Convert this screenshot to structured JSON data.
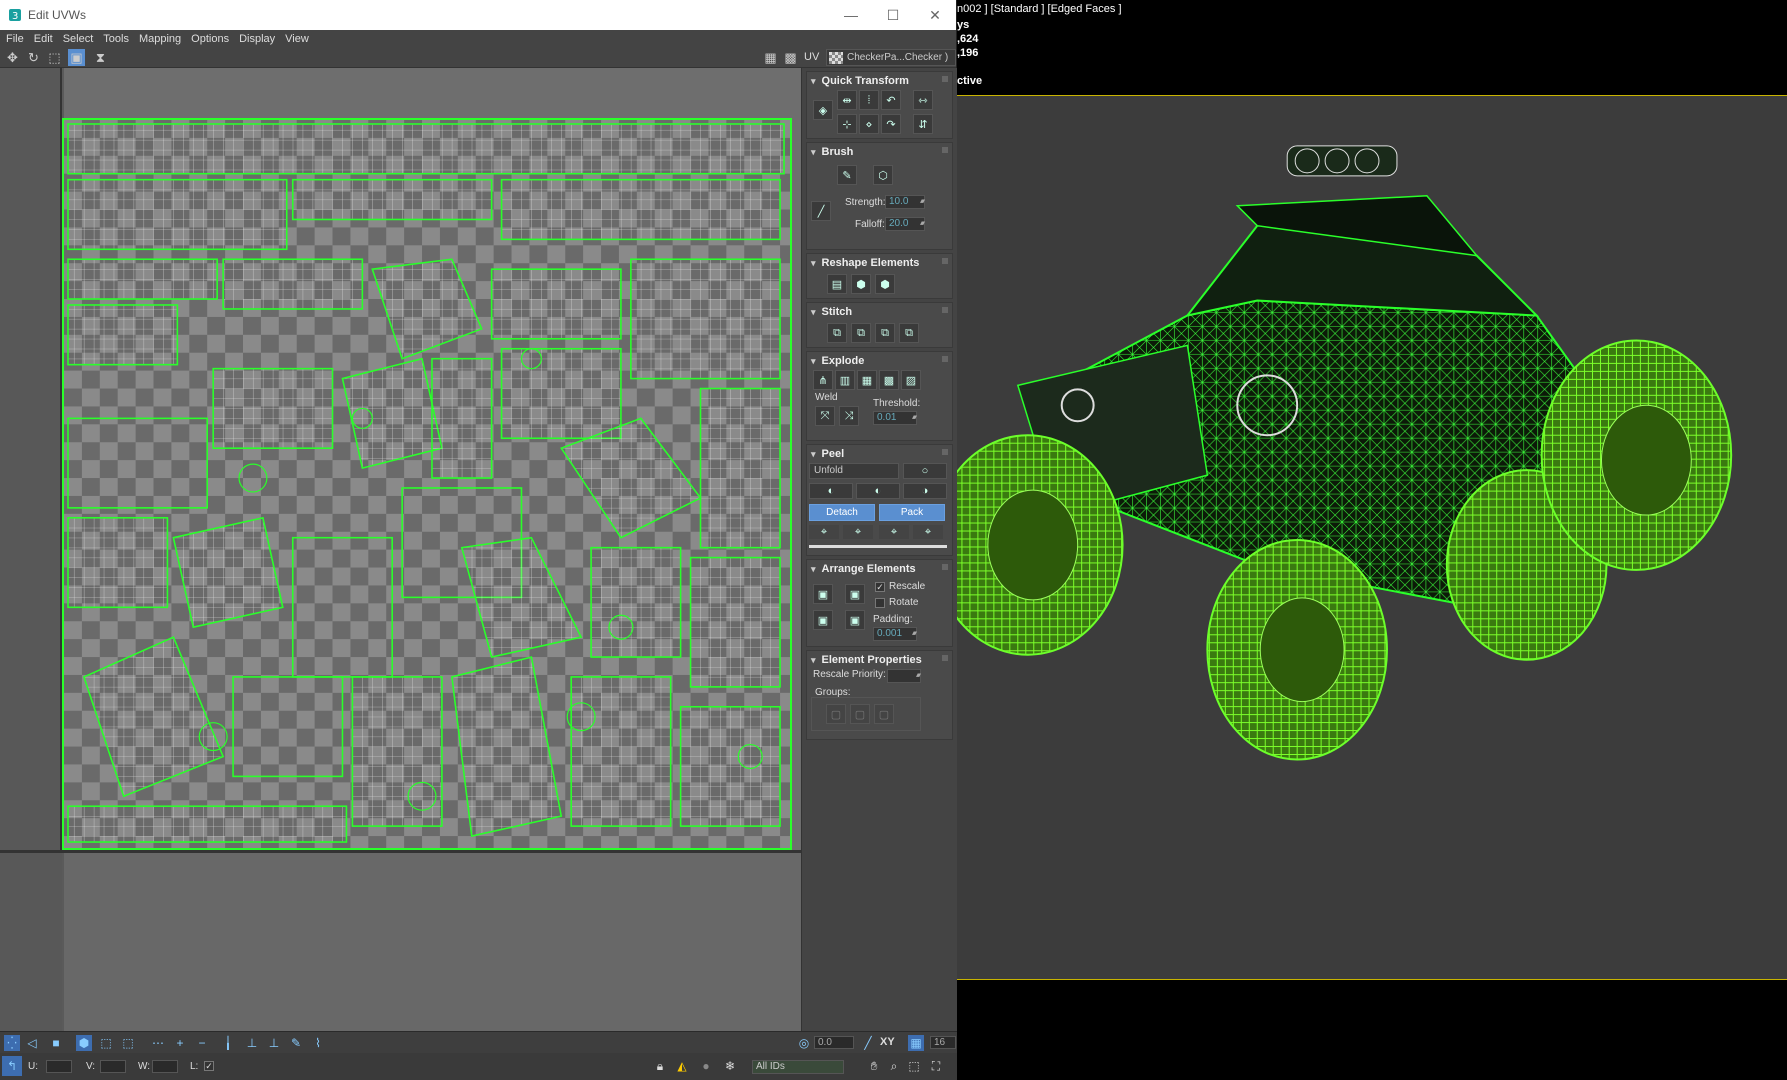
{
  "window": {
    "title": "Edit UVWs",
    "controls": {
      "minimize": "—",
      "maximize": "☐",
      "close": "✕"
    }
  },
  "menu": [
    "File",
    "Edit",
    "Select",
    "Tools",
    "Mapping",
    "Options",
    "Display",
    "View"
  ],
  "toolbar": {
    "uv_label": "UV",
    "texture_dropdown": "CheckerPa...Checker )"
  },
  "panel": {
    "quick_transform": {
      "title": "Quick Transform"
    },
    "brush": {
      "title": "Brush",
      "strength_label": "Strength:",
      "strength_value": "10.0",
      "falloff_label": "Falloff:",
      "falloff_value": "20.0"
    },
    "reshape": {
      "title": "Reshape Elements"
    },
    "stitch": {
      "title": "Stitch"
    },
    "explode": {
      "title": "Explode",
      "weld_label": "Weld",
      "threshold_label": "Threshold:",
      "threshold_value": "0.01"
    },
    "peel": {
      "title": "Peel",
      "method": "Unfold",
      "detach_label": "Detach",
      "pack_label": "Pack"
    },
    "arrange": {
      "title": "Arrange Elements",
      "rescale_label": "Rescale",
      "rotate_label": "Rotate",
      "padding_label": "Padding:",
      "padding_value": "0.001"
    },
    "element_properties": {
      "title": "Element Properties",
      "rescale_priority_label": "Rescale Priority:",
      "groups_label": "Groups:"
    }
  },
  "bottom": {
    "angle_value": "0.0",
    "xy_label": "XY",
    "grid_value": "16",
    "u_label": "U:",
    "v_label": "V:",
    "w_label": "W:",
    "l_label": "L:",
    "ids_dropdown": "All IDs"
  },
  "viewport": {
    "label": "n002 ] [Standard ] [Edged Faces ]",
    "stats": [
      "ys",
      ",624",
      ",196",
      "",
      "ctive"
    ]
  },
  "colors": {
    "wire": "#2aff2a",
    "accent_blue": "#5a8fd0",
    "viewport_bg": "#3c3c3c",
    "panel_bg": "#444444"
  }
}
